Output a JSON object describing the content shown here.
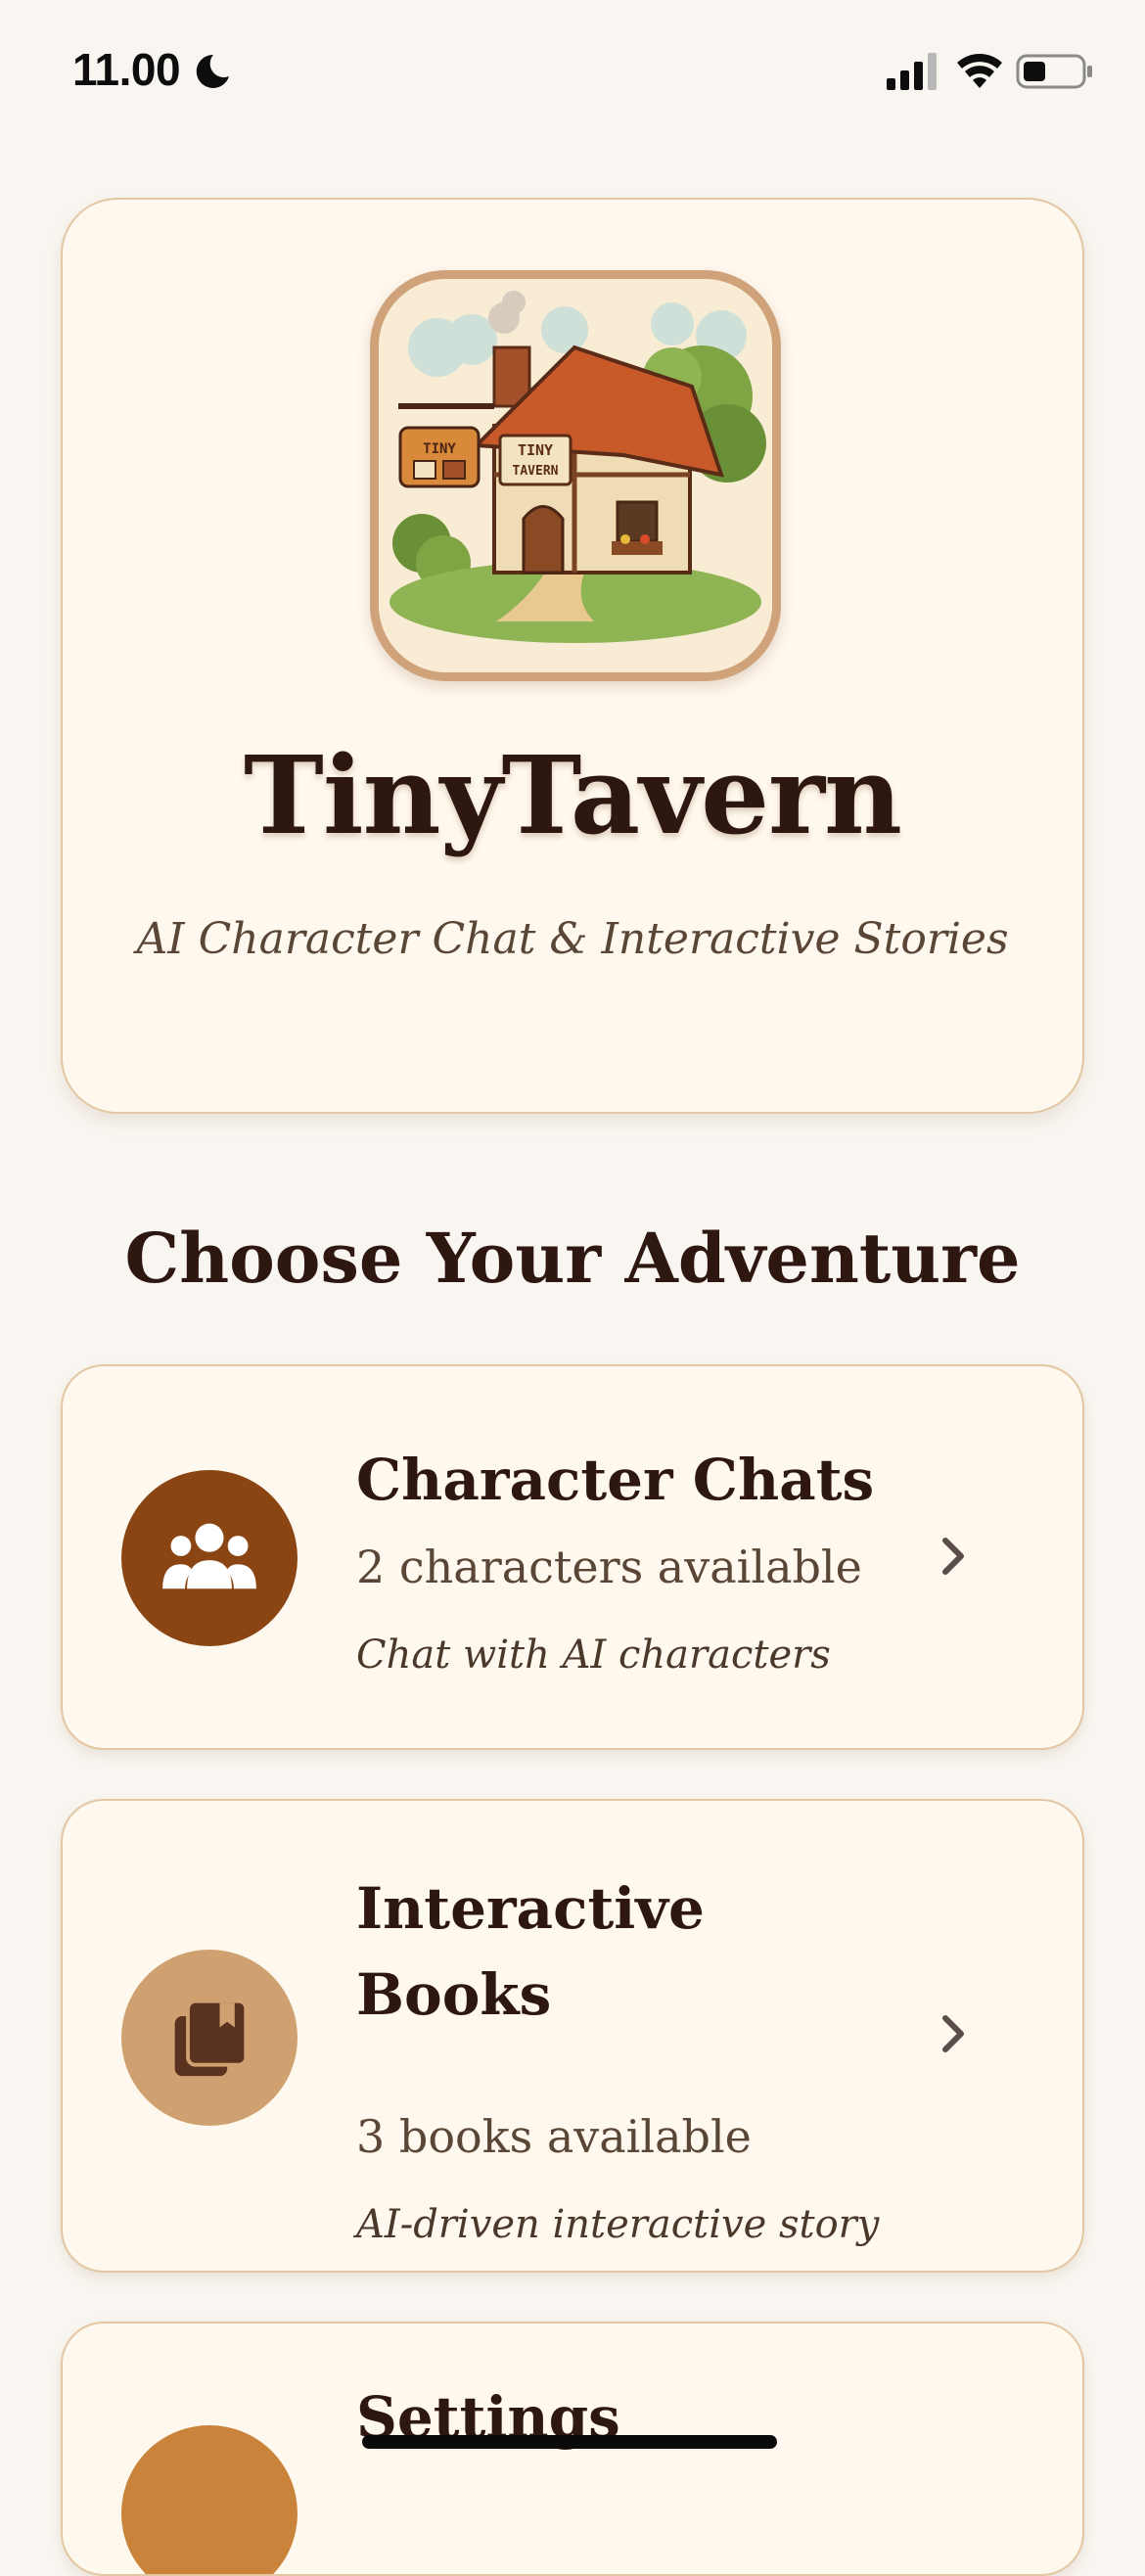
{
  "status_bar": {
    "time": "11.00",
    "icons": [
      "moon-icon",
      "signal-icon",
      "wifi-icon",
      "battery-icon"
    ]
  },
  "hero": {
    "logo_icon": "tavern-house-logo",
    "logo_text": "TINY TAVERN",
    "title": "TinyTavern",
    "subtitle": "AI Character Chat & Interactive Stories"
  },
  "section": {
    "heading": "Choose Your Adventure"
  },
  "menu": [
    {
      "title": "Character Chats",
      "count": "2 characters available",
      "description": "Chat with AI characters",
      "icon": "people-group-icon",
      "icon_color": "#8a4513"
    },
    {
      "title": "Interactive Books",
      "count": "3 books available",
      "description": "AI-driven interactive story",
      "icon": "book-stack-icon",
      "icon_color": "#cfa070"
    },
    {
      "title": "Settings",
      "icon": "settings-icon",
      "icon_color": "#c9833a"
    }
  ],
  "colors": {
    "background": "#f9f6f1",
    "card_background": "#fff8ee",
    "card_border": "#e3c6a2",
    "title_text": "#2e1710",
    "secondary_text": "#5a4636"
  }
}
